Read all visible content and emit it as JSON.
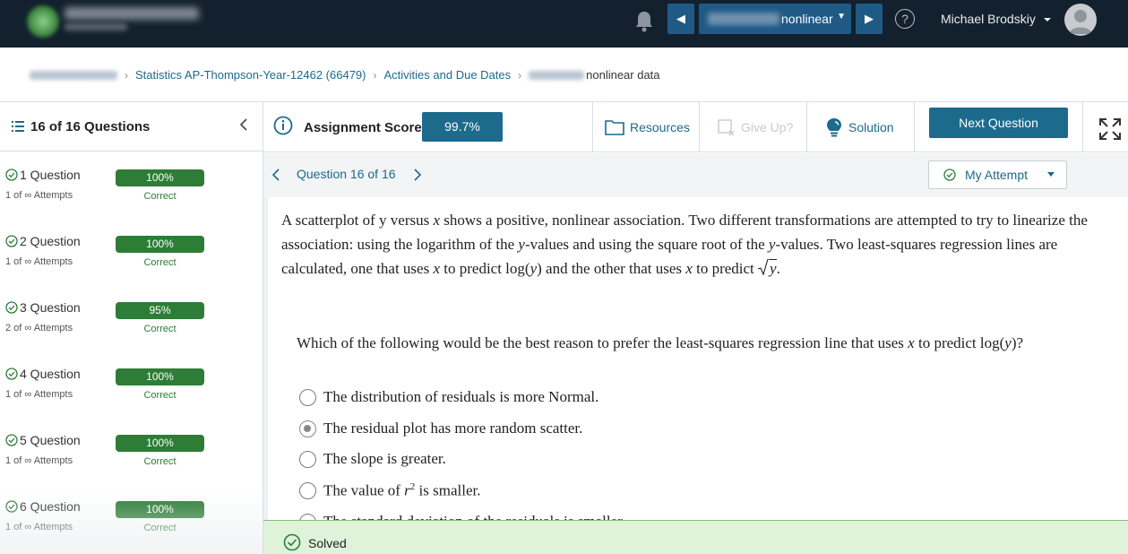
{
  "header": {
    "assignment_suffix": "nonlinear",
    "user_name": "Michael Brodskiy",
    "prev_symbol": "◀",
    "next_symbol": "▶",
    "help_symbol": "?",
    "caret": "▼"
  },
  "breadcrumb": {
    "course": "Statistics AP-Thompson-Year-12462 (66479)",
    "activities": "Activities and Due Dates",
    "current": "nonlinear data"
  },
  "sidebar": {
    "title": "16 of 16 Questions",
    "questions": [
      {
        "title": "1 Question",
        "attempts": "1 of ∞ Attempts",
        "score": "100%",
        "status": "Correct"
      },
      {
        "title": "2 Question",
        "attempts": "1 of ∞ Attempts",
        "score": "100%",
        "status": "Correct"
      },
      {
        "title": "3 Question",
        "attempts": "2 of ∞ Attempts",
        "score": "95%",
        "status": "Correct"
      },
      {
        "title": "4 Question",
        "attempts": "1 of ∞ Attempts",
        "score": "100%",
        "status": "Correct"
      },
      {
        "title": "5 Question",
        "attempts": "1 of ∞ Attempts",
        "score": "100%",
        "status": "Correct"
      },
      {
        "title": "6 Question",
        "attempts": "1 of ∞ Attempts",
        "score": "100%",
        "status": "Correct"
      }
    ]
  },
  "toolbar": {
    "score_label": "Assignment Score:",
    "score_value": "99.7%",
    "resources": "Resources",
    "give_up": "Give Up?",
    "solution": "Solution",
    "next_question": "Next Question"
  },
  "question": {
    "nav_label": "Question 16 of 16",
    "attempt_label": "My Attempt",
    "stem_1": "A scatterplot of y versus ",
    "stem_2": " shows a positive, nonlinear association. Two different transformations are attempted to try to linearize the association: using the logarithm of the ",
    "stem_3": "-values and using the square root of the ",
    "stem_4": "-values. Two least-squares regression lines are calculated, one that uses ",
    "stem_5": " to predict log(",
    "stem_6": ") and the other that uses ",
    "stem_7": " to predict ",
    "stem_end": ".",
    "var_x": "x",
    "var_y": "y",
    "prompt_1": "Which of the following would be the best reason to prefer the least-squares regression line that uses ",
    "prompt_2": " to predict log(",
    "prompt_3": ")?",
    "options": [
      "The distribution of residuals is more Normal.",
      "The residual plot has more random scatter.",
      "The slope is greater.",
      "The value of ",
      "The standard deviation of the residuals is smaller."
    ],
    "option4_suffix": " is smaller.",
    "option4_var": "r",
    "option4_exp": "2",
    "selected_option": 1
  },
  "status": {
    "solved": "Solved"
  },
  "colors": {
    "topbar": "#13212e",
    "accent": "#1c6a8c",
    "nav_button": "#1f5a86",
    "correct_green": "#2d7d36",
    "solved_bg": "#dff2da"
  }
}
